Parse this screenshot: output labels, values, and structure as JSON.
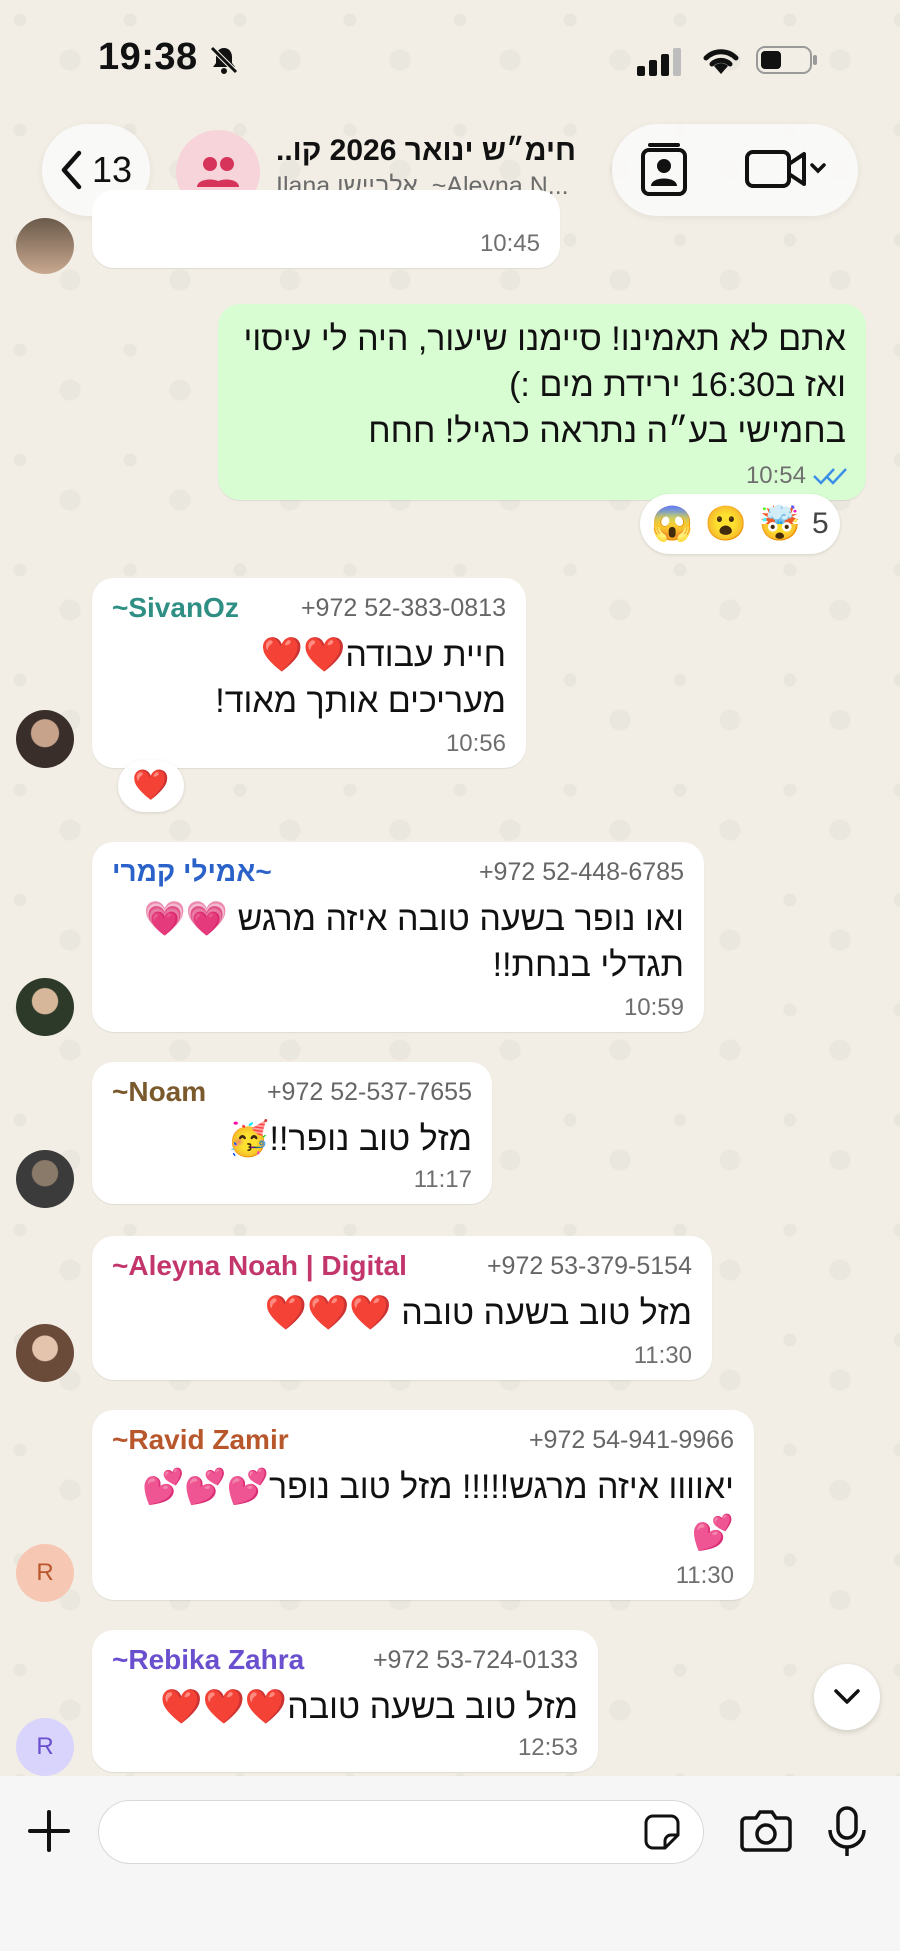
{
  "status_bar": {
    "time": "19:38"
  },
  "header": {
    "back_count": "13",
    "title": "חימ״ש ינואר 2026 קו...",
    "subtitle": "Ilana אלביישן, ~Aleyna N..."
  },
  "messages": [
    {
      "time": "10:45"
    },
    {
      "lines": [
        "אתם לא תאמינו! סיימנו שיעור, היה לי עיסוי",
        "ואז ב16:30 ירידת מים :)",
        "בחמישי בע״ה נתראה כרגיל! חחח"
      ],
      "time": "10:54",
      "reactions": {
        "emojis": [
          "😱",
          "😮",
          "🤯"
        ],
        "count": "5"
      }
    },
    {
      "sender": "~SivanOz",
      "phone": "+972 52-383-0813",
      "lines": [
        "חיית עבודה❤️❤️",
        "מעריכים אותך מאוד!"
      ],
      "time": "10:56",
      "reaction": "❤️",
      "sender_color": "#2f8f84"
    },
    {
      "sender": "~אמילי קמרי",
      "phone": "+972 52-448-6785",
      "lines": [
        "ואו נופר בשעה טובה איזה מרגש 💗💗",
        "תגדלי בנחת!!"
      ],
      "time": "10:59",
      "sender_color": "#2a62c9"
    },
    {
      "sender": "~Noam",
      "phone": "+972 52-537-7655",
      "lines": [
        "מזל טוב נופר!!🥳"
      ],
      "time": "11:17",
      "sender_color": "#7a5a2d"
    },
    {
      "sender": "~Aleyna Noah | Digital",
      "phone": "+972 53-379-5154",
      "lines": [
        "מזל טוב בשעה טובה ❤️❤️❤️"
      ],
      "time": "11:30",
      "sender_color": "#c2366b"
    },
    {
      "sender": "~Ravid Zamir",
      "phone": "+972 54-941-9966",
      "lines": [
        "יאוווו איזה מרגש!!!!! מזל טוב נופר💕💕💕",
        "💕"
      ],
      "time": "11:30",
      "avatar_letter": "R",
      "sender_color": "#b8572c"
    },
    {
      "sender": "~Rebika Zahra",
      "phone": "+972 53-724-0133",
      "lines": [
        "מזל טוב בשעה טובה❤️❤️❤️"
      ],
      "time": "12:53",
      "avatar_letter": "R",
      "sender_color": "#6a4fcf"
    }
  ],
  "icons": [
    "back-chevron-icon",
    "group-icon",
    "contact-card-icon",
    "video-camera-icon",
    "chevron-down-icon",
    "plus-icon",
    "sticker-icon",
    "camera-icon",
    "microphone-icon",
    "double-check-icon"
  ]
}
